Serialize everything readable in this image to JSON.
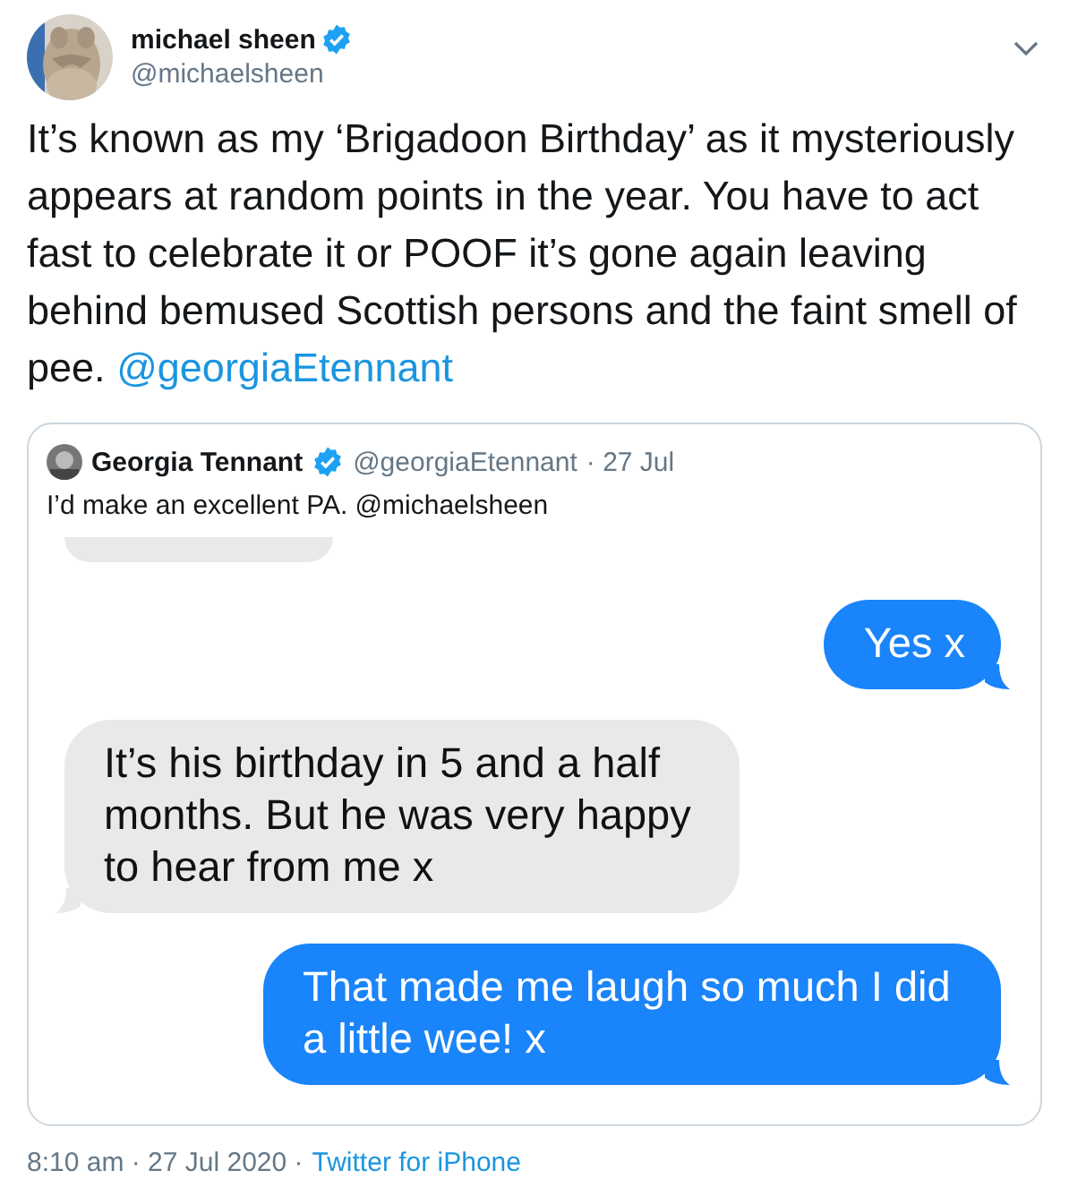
{
  "author": {
    "name": "michael sheen",
    "handle": "@michaelsheen",
    "verified": true
  },
  "tweet": {
    "text": "It’s known as my ‘Brigadoon Birthday’ as it mysteriously appears at random points in the year. You have to act fast to celebrate it or POOF it’s gone again leaving behind bemused Scottish persons and the faint smell of pee.",
    "mention": "@georgiaEtennant"
  },
  "quote": {
    "name": "Georgia Tennant",
    "verified": true,
    "handle": "@georgiaEtennant",
    "date": "· 27 Jul",
    "text": "I’d make an excellent PA. @michaelsheen",
    "messages": [
      {
        "kind": "sent",
        "text": "Yes x"
      },
      {
        "kind": "received",
        "text": "It’s his birthday in 5 and a half months. But he was very happy to hear from me x"
      },
      {
        "kind": "sent",
        "text": "That made me laugh so much I did a little wee! x"
      }
    ]
  },
  "footer": {
    "time": "8:10 am · 27 Jul 2020 ·",
    "source": "Twitter for iPhone"
  }
}
